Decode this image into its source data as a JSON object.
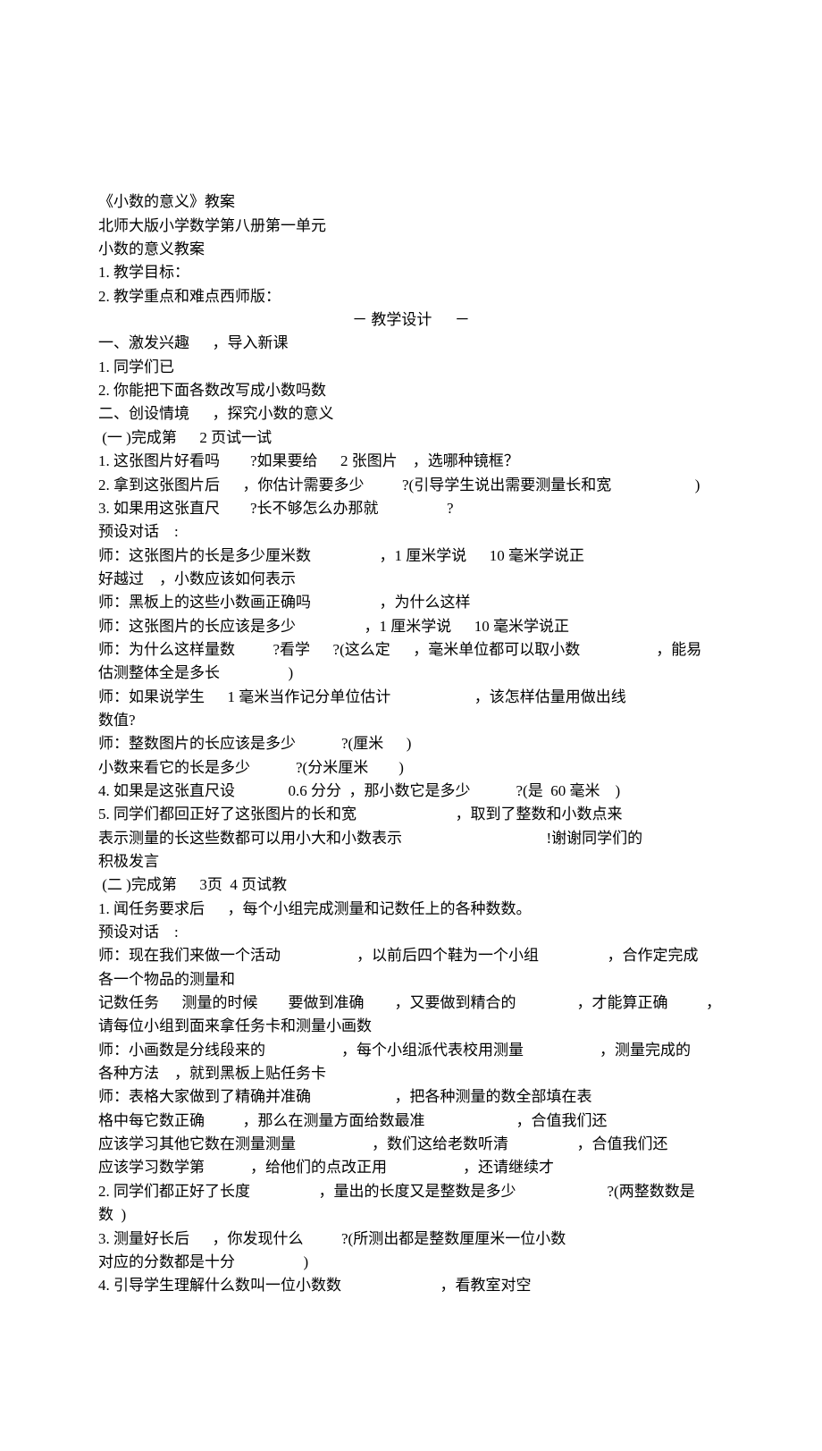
{
  "lines": [
    {
      "t": "《小数的意义》教案"
    },
    {
      "t": "北师大版小学数学第八册第一单元"
    },
    {
      "t": "小数的意义教案"
    },
    {
      "t": "1. 教学目标："
    },
    {
      "t": "2. 教学重点和难点西师版："
    },
    {
      "t": "－ 教学设计      －",
      "center": true
    },
    {
      "t": "一、激发兴趣      ，导入新课"
    },
    {
      "t": "1. 同学们已"
    },
    {
      "t": "2. 你能把下面各数改写成小数吗数"
    },
    {
      "t": "二、创设情境      ，探究小数的意义"
    },
    {
      "t": " (一 )完成第      2 页试一试"
    },
    {
      "t": "1. 这张图片好看吗        ?如果要给      2 张图片    ，选哪种镜框？"
    },
    {
      "t": "2. 拿到这张图片后      ，你估计需要多少          ?(引导学生说出需要测量长和宽                      )"
    },
    {
      "t": "3. 如果用这张直尺        ?长不够怎么办那就                  ?"
    },
    {
      "t": "预设对话    :"
    },
    {
      "t": "师：这张图片的长是多少厘米数                  ，1 厘米学说      10 毫米学说正"
    },
    {
      "t": "好越过    ，小数应该如何表示"
    },
    {
      "t": "师：黑板上的这些小数画正确吗                  ，为什么这样"
    },
    {
      "t": "师：这张图片的长应该是多少                  ，1 厘米学说      10 毫米学说正"
    },
    {
      "t": "师：为什么这样量数          ?看学      ?(这么定      ，毫米单位都可以取小数                    ，能易"
    },
    {
      "t": "估测整体全是多长                  )"
    },
    {
      "t": "师：如果说学生      1 毫米当作记分单位估计                      ，该怎样估量用做出线"
    },
    {
      "t": "数值?"
    },
    {
      "t": "师：整数图片的长应该是多少            ?(厘米      )"
    },
    {
      "t": "小数来看它的长是多少            ?(分米厘米        )"
    },
    {
      "t": "4. 如果是这张直尺设              0.6 分分  ，那小数它是多少            ?(是  60 毫米    )"
    },
    {
      "t": "5. 同学们都回正好了这张图片的长和宽                          ，取到了整数和小数点来"
    },
    {
      "t": "表示测量的长这些数都可以用小大和小数表示                                      !谢谢同学们的"
    },
    {
      "t": "积极发言"
    },
    {
      "t": " (二 )完成第      3页  4 页试教"
    },
    {
      "t": "1. 闻任务要求后      ，每个小组完成测量和记数任上的各种数数。"
    },
    {
      "t": "预设对话    :"
    },
    {
      "t": "师：现在我们来做一个活动                    ，以前后四个鞋为一个小组                  ，合作定完成"
    },
    {
      "t": "各一个物品的测量和"
    },
    {
      "t": "记数任务      测量的时候        要做到准确        ，又要做到精合的                ，才能算正确          ，"
    },
    {
      "t": "请每位小组到面来拿任务卡和测量小画数"
    },
    {
      "t": "师：小画数是分线段来的                    ，每个小组派代表校用测量                    ，测量完成的"
    },
    {
      "t": "各种方法    ，就到黑板上贴任务卡"
    },
    {
      "t": "师：表格大家做到了精确并准确                      ，把各种测量的数全部填在表"
    },
    {
      "t": "格中每它数正确          ，那么在测量方面给数最准                        ，合值我们还"
    },
    {
      "t": "应该学习其他它数在测量测量                    ，数们这给老数听清                  ，合值我们还"
    },
    {
      "t": "应该学习数学第            ，给他们的点改正用                    ，还请继续才"
    },
    {
      "t": "2. 同学们都正好了长度                  ，量出的长度又是整数是多少                        ?(两整数数是"
    },
    {
      "t": "数  )"
    },
    {
      "t": "3. 测量好长后      ，你发现什么          ?(所测出都是整数厘厘米一位小数"
    },
    {
      "t": "对应的分数都是十分                  )"
    },
    {
      "t": "4. 引导学生理解什么数叫一位小数数                          ，看教室对空"
    }
  ]
}
